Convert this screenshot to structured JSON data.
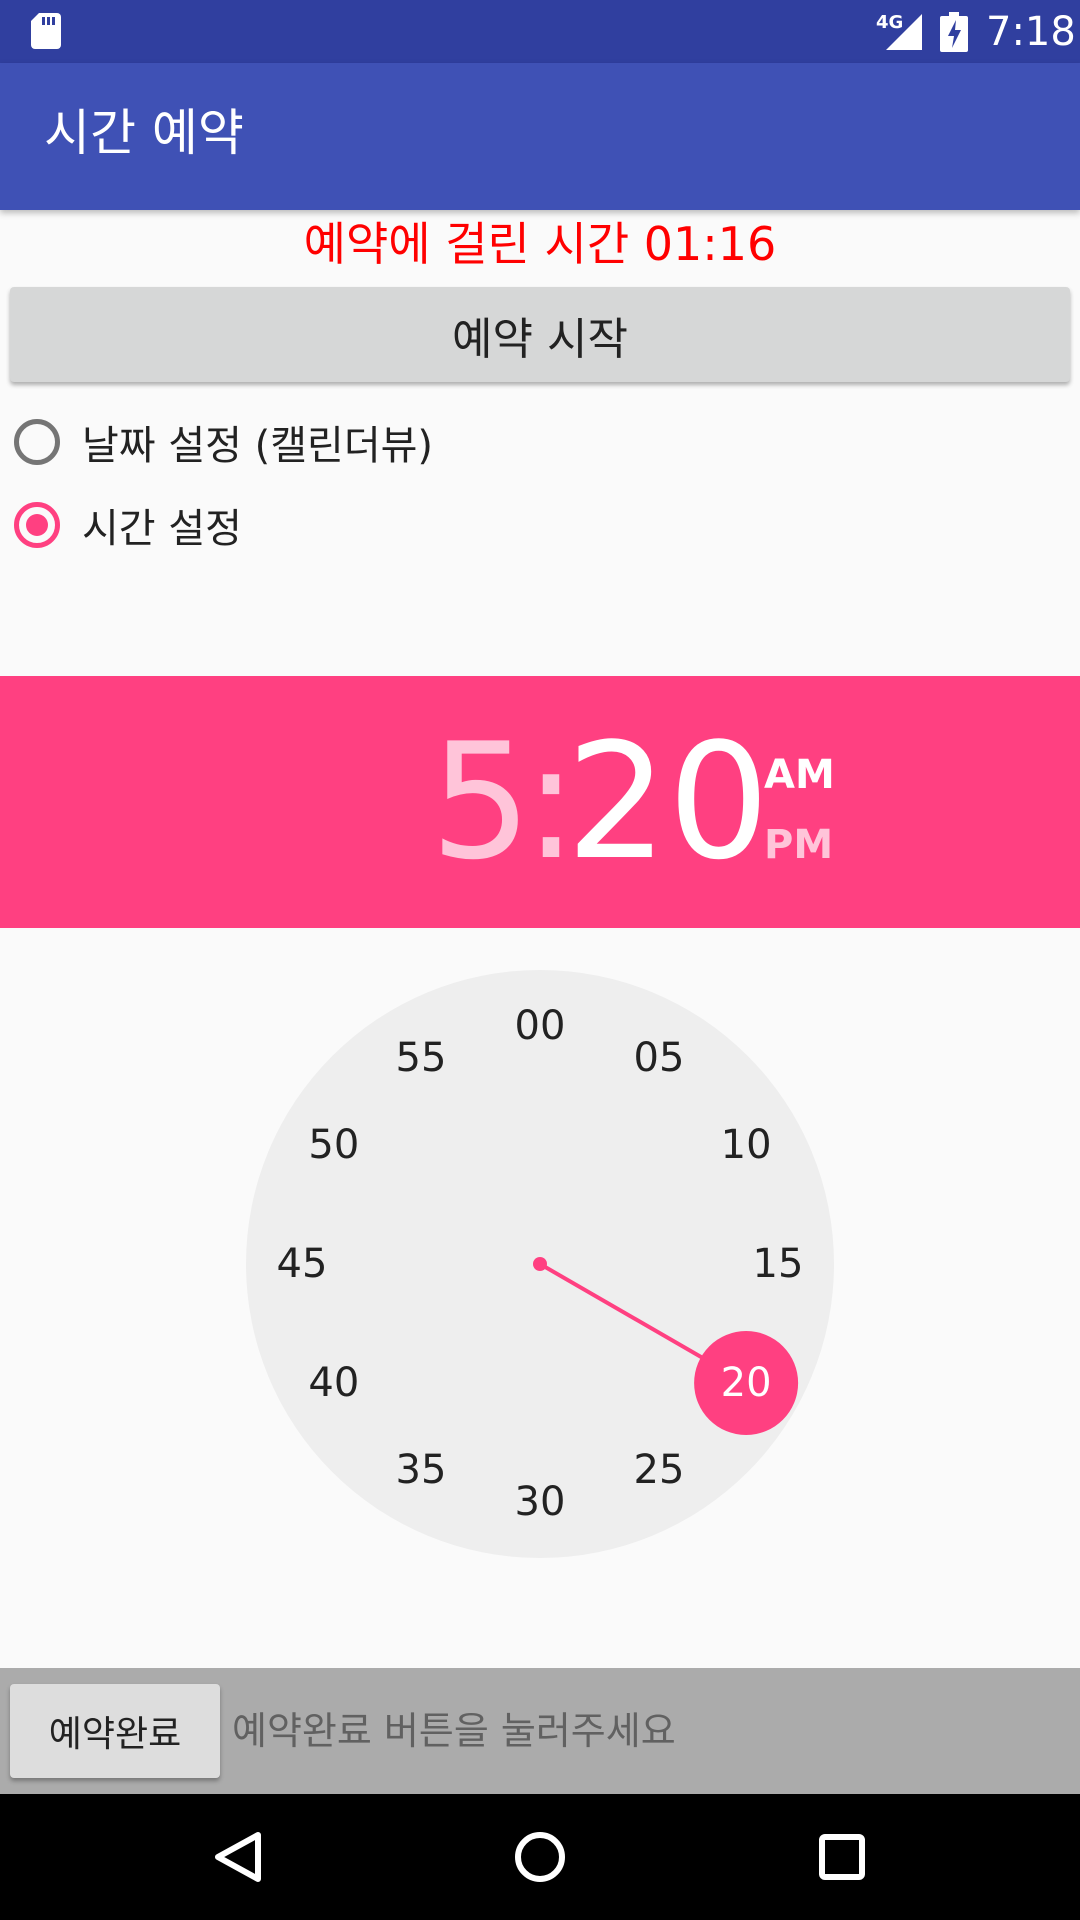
{
  "status_bar": {
    "time": "7:18",
    "network": "4G",
    "icons": [
      "sd-card-icon",
      "signal-icon",
      "battery-charging-icon"
    ]
  },
  "app_bar": {
    "title": "시간 예약"
  },
  "elapsed_text": "예약에 걸린 시간 01:16",
  "start_button": "예약 시작",
  "radios": {
    "date_label": "날짜 설정 (캘린더뷰)",
    "date_checked": false,
    "time_label": "시간 설정",
    "time_checked": true
  },
  "time_picker": {
    "hour": "5",
    "separator": ":",
    "minute": "20",
    "am": "AM",
    "pm": "PM",
    "selected_period": "AM",
    "dial_labels": [
      "00",
      "05",
      "10",
      "15",
      "20",
      "25",
      "30",
      "35",
      "40",
      "45",
      "50",
      "55"
    ],
    "selected_minute_label": "20",
    "accent": "#FF4081"
  },
  "bottom": {
    "done_button": "예약완료",
    "hint": "예약완료 버튼을 눌러주세요"
  },
  "nav_bar": {
    "icons": [
      "back-icon",
      "home-icon",
      "recents-icon"
    ]
  },
  "colors": {
    "status_bar": "#303F9F",
    "app_bar": "#3F51B5",
    "elapsed_text": "#FF0000",
    "accent": "#FF4081"
  }
}
